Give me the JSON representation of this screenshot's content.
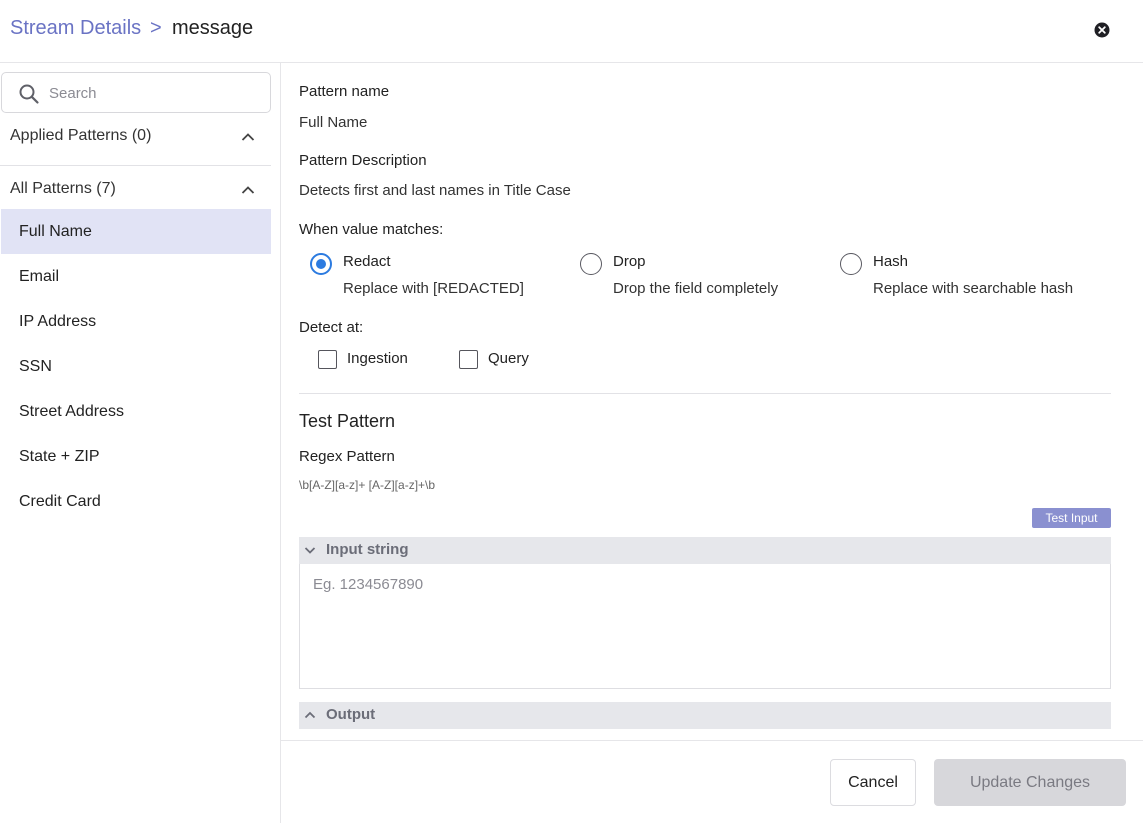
{
  "header": {
    "breadcrumb_link": "Stream Details",
    "breadcrumb_separator": ">",
    "breadcrumb_current": "message",
    "close_icon": "close-circle-icon"
  },
  "sidebar": {
    "search_placeholder": "Search",
    "applied_label": "Applied Patterns (0)",
    "all_label": "All Patterns (7)",
    "patterns": [
      {
        "label": "Full Name"
      },
      {
        "label": "Email"
      },
      {
        "label": "IP Address"
      },
      {
        "label": "SSN"
      },
      {
        "label": "Street Address"
      },
      {
        "label": "State + ZIP"
      },
      {
        "label": "Credit Card"
      }
    ],
    "active_pattern": "Full Name",
    "active_bg": "#e1e3f5"
  },
  "details": {
    "name_label": "Pattern name",
    "name_value": "Full Name",
    "desc_label": "Pattern Description",
    "desc_value": "Detects first and last names in Title Case",
    "match_label": "When value matches:",
    "options": [
      {
        "name": "Redact",
        "desc": "Replace with [REDACTED]",
        "selected": true
      },
      {
        "name": "Drop",
        "desc": "Drop the field completely",
        "selected": false
      },
      {
        "name": "Hash",
        "desc": "Replace with searchable hash",
        "selected": false
      }
    ],
    "detect_label": "Detect at:",
    "detect_options": [
      {
        "label": "Ingestion",
        "checked": false
      },
      {
        "label": "Query",
        "checked": false
      }
    ]
  },
  "test": {
    "title": "Test Pattern",
    "regex_label": "Regex Pattern",
    "regex_value": "\\b[A-Z][a-z]+ [A-Z][a-z]+\\b",
    "test_button": "Test Input",
    "input_header": "Input string",
    "input_placeholder": "Eg. 1234567890",
    "output_header": "Output"
  },
  "footer": {
    "cancel_label": "Cancel",
    "update_label": "Update Changes"
  },
  "colors": {
    "accent": "#6a73c4",
    "radio_selected": "#2c7be0",
    "test_button_bg": "#8a90d0"
  }
}
